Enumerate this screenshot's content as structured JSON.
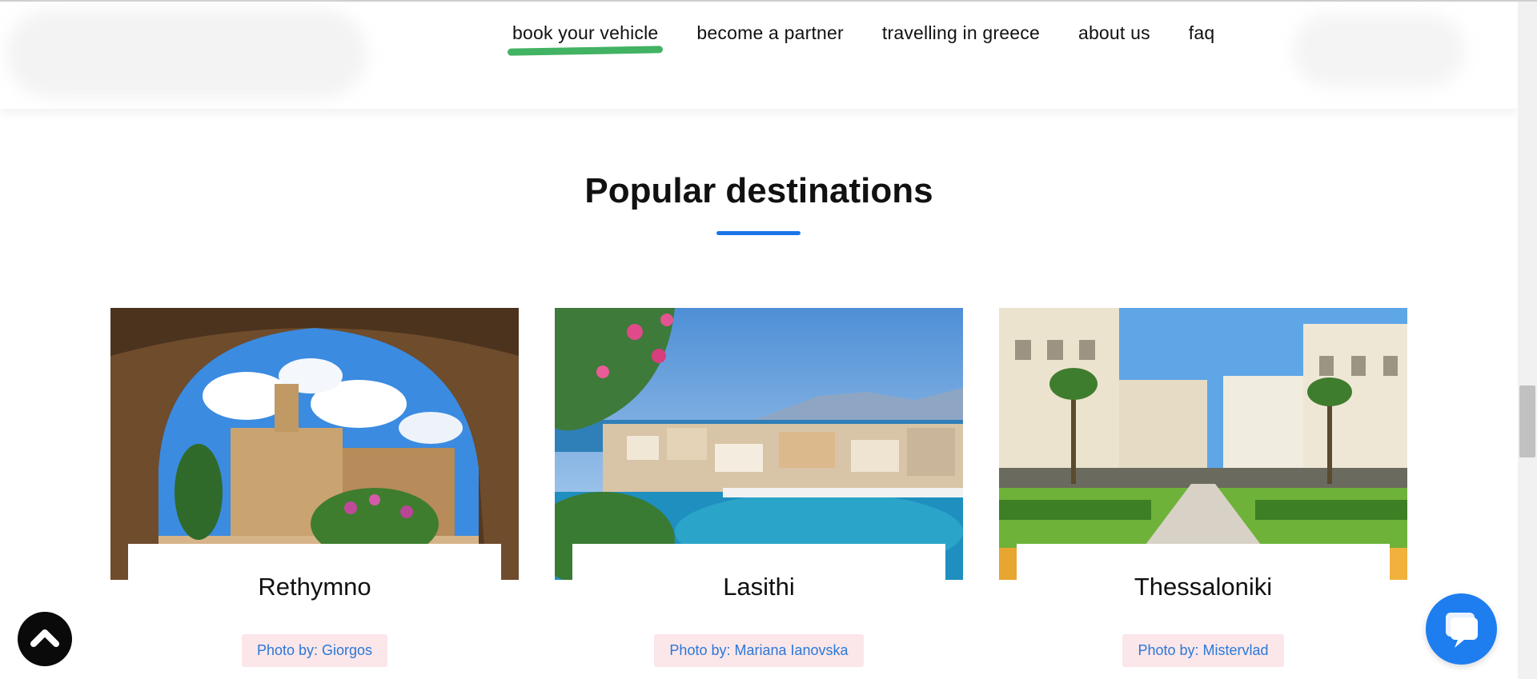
{
  "nav": {
    "items": [
      {
        "label": "book your vehicle",
        "active": true
      },
      {
        "label": "become a partner"
      },
      {
        "label": "travelling in greece"
      },
      {
        "label": "about us"
      },
      {
        "label": "faq"
      }
    ],
    "active_underline_color": "#2eaa52"
  },
  "section": {
    "title": "Popular destinations",
    "accent_color": "#1a75e8"
  },
  "destinations": [
    {
      "name": "Rethymno",
      "credit": "Photo by: Giorgos"
    },
    {
      "name": "Lasithi",
      "credit": "Photo by: Mariana Ianovska"
    },
    {
      "name": "Thessaloniki",
      "credit": "Photo by: Mistervlad"
    }
  ],
  "buttons": {
    "back_to_top_icon": "chevron-up-icon",
    "chat_icon": "chat-icon",
    "chat_color": "#1e7ef0"
  }
}
